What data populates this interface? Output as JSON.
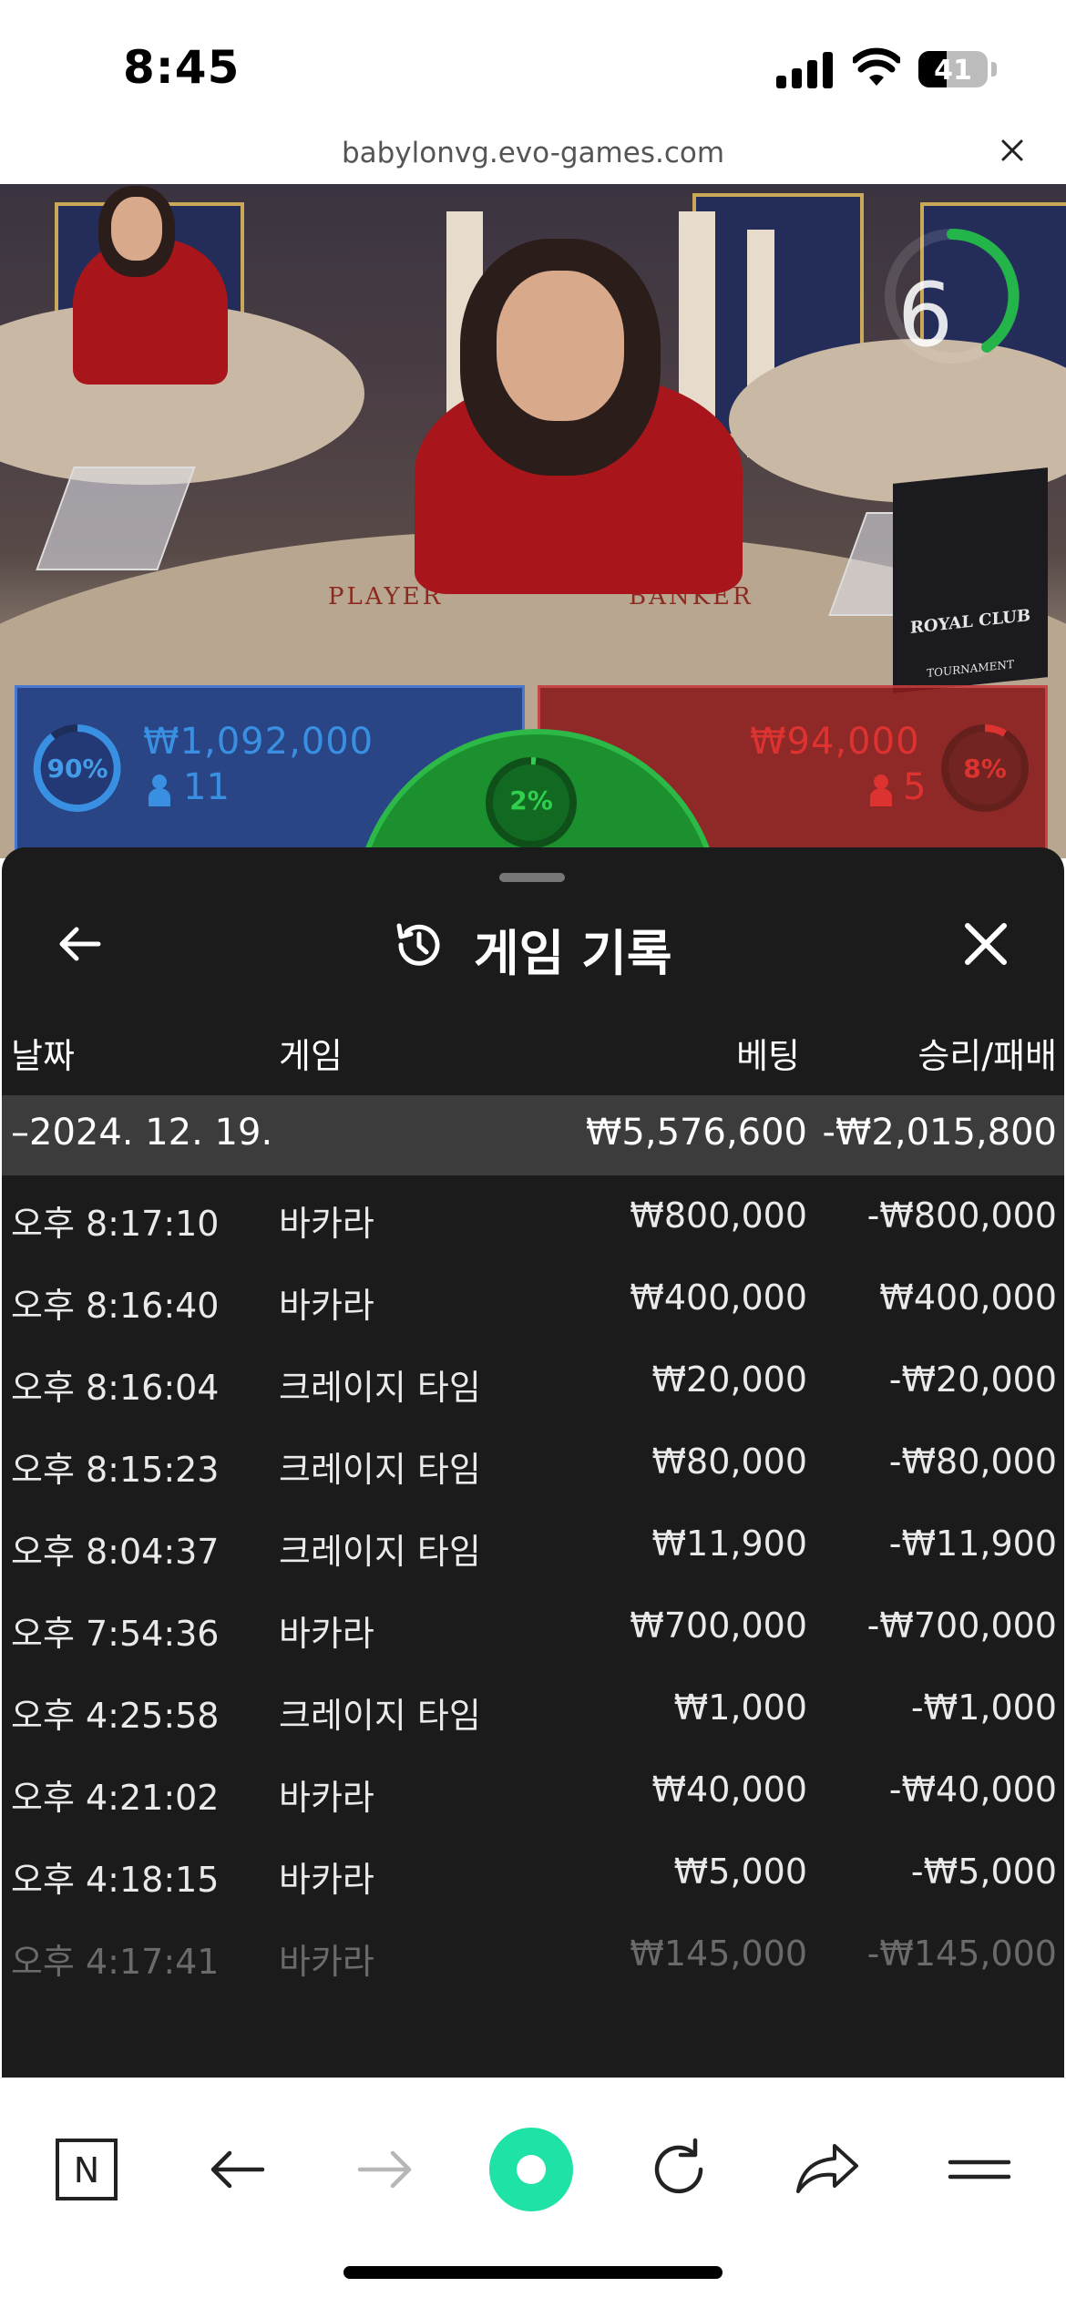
{
  "status_bar": {
    "time": "8:45",
    "battery": "41"
  },
  "url_bar": {
    "domain": "babylonvg.evo-games.com"
  },
  "game": {
    "timer": "6",
    "felt_player": "PLAYER",
    "felt_banker": "BANKER",
    "sign_title": "ROYAL CLUB",
    "sign_subtitle": "TOURNAMENT",
    "player": {
      "percent": "90%",
      "amount": "₩1,092,000",
      "count": "11",
      "share": 0.9
    },
    "tie": {
      "percent": "2%",
      "share": 0.02
    },
    "banker": {
      "percent": "8%",
      "amount": "₩94,000",
      "count": "5",
      "share": 0.08
    }
  },
  "history": {
    "title": "게임 기록",
    "columns": {
      "date": "날짜",
      "game": "게임",
      "bet": "베팅",
      "result": "승리/패배"
    },
    "day": {
      "date": "–2024. 12. 19.",
      "bet_total": "₩5,576,600",
      "result_total": "-₩2,015,800"
    },
    "rows": [
      {
        "time": "오후 8:17:10",
        "game": "바카라",
        "bet": "₩800,000",
        "result": "-₩800,000"
      },
      {
        "time": "오후 8:16:40",
        "game": "바카라",
        "bet": "₩400,000",
        "result": "₩400,000"
      },
      {
        "time": "오후 8:16:04",
        "game": "크레이지 타임",
        "bet": "₩20,000",
        "result": "-₩20,000"
      },
      {
        "time": "오후 8:15:23",
        "game": "크레이지 타임",
        "bet": "₩80,000",
        "result": "-₩80,000"
      },
      {
        "time": "오후 8:04:37",
        "game": "크레이지 타임",
        "bet": "₩11,900",
        "result": "-₩11,900"
      },
      {
        "time": "오후 7:54:36",
        "game": "바카라",
        "bet": "₩700,000",
        "result": "-₩700,000"
      },
      {
        "time": "오후 4:25:58",
        "game": "크레이지 타임",
        "bet": "₩1,000",
        "result": "-₩1,000"
      },
      {
        "time": "오후 4:21:02",
        "game": "바카라",
        "bet": "₩40,000",
        "result": "-₩40,000"
      },
      {
        "time": "오후 4:18:15",
        "game": "바카라",
        "bet": "₩5,000",
        "result": "-₩5,000"
      },
      {
        "time": "오후 4:17:41",
        "game": "바카라",
        "bet": "₩145,000",
        "result": "-₩145,000"
      }
    ]
  },
  "toolbar": {
    "icons": [
      "naver-n-icon",
      "back-arrow-icon",
      "forward-arrow-icon",
      "green-dot-icon",
      "reload-icon",
      "share-icon",
      "menu-icon"
    ],
    "naver_letter": "N"
  },
  "colors": {
    "player_blue": "#1e3d86",
    "banker_red": "#8b1c1c",
    "tie_green": "#1c8f2e",
    "timer_green": "#23b44a",
    "sheet_bg": "#1b1b1b",
    "accent_mint": "#1fe3a6"
  }
}
